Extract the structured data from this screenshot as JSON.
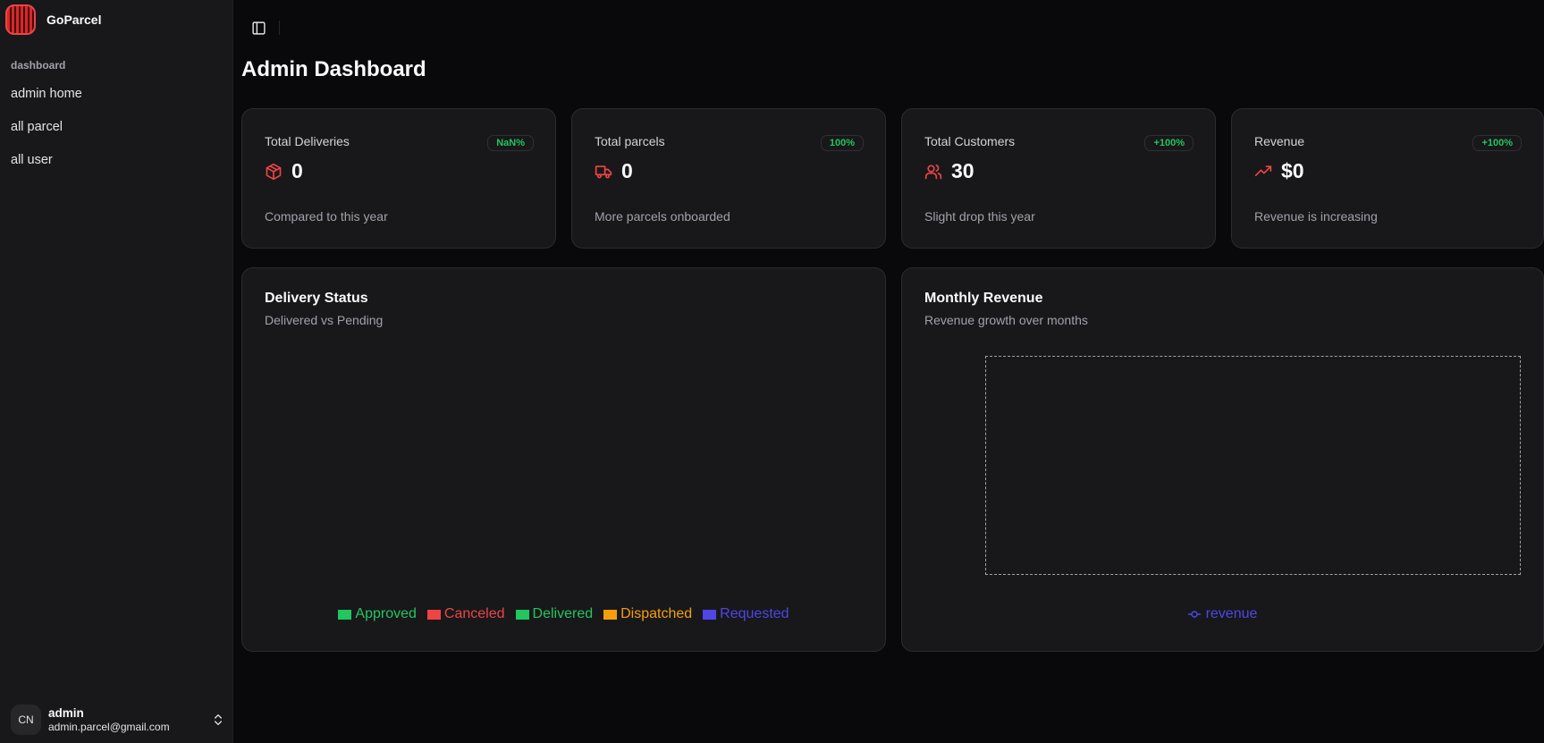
{
  "app": {
    "name": "GoParcel"
  },
  "sidebar": {
    "group_label": "dashboard",
    "items": [
      {
        "label": "admin home"
      },
      {
        "label": "all parcel"
      },
      {
        "label": "all user"
      }
    ],
    "user": {
      "initials": "CN",
      "name": "admin",
      "email": "admin.parcel@gmail.com"
    }
  },
  "main": {
    "title": "Admin Dashboard",
    "stats": [
      {
        "label": "Total Deliveries",
        "badge": "NaN%",
        "value": "0",
        "footer": "Compared to this year",
        "icon": "package-icon"
      },
      {
        "label": "Total parcels",
        "badge": "100%",
        "value": "0",
        "footer": "More parcels onboarded",
        "icon": "truck-icon"
      },
      {
        "label": "Total Customers",
        "badge": "+100%",
        "value": "30",
        "footer": "Slight drop this year",
        "icon": "users-icon"
      },
      {
        "label": "Revenue",
        "badge": "+100%",
        "value": "$0",
        "footer": "Revenue is increasing",
        "icon": "trending-up-icon"
      }
    ],
    "delivery_chart": {
      "title": "Delivery Status",
      "subtitle": "Delivered vs Pending"
    },
    "revenue_chart": {
      "title": "Monthly Revenue",
      "subtitle": "Revenue growth over months"
    }
  },
  "colors": {
    "accent_red": "#ef4444",
    "success": "#22c55e",
    "approved": "#22c55e",
    "canceled": "#ef4444",
    "delivered": "#22c55e",
    "dispatched": "#f59e0b",
    "requested": "#4f46e5"
  },
  "chart_data": [
    {
      "type": "pie",
      "title": "Delivery Status",
      "subtitle": "Delivered vs Pending",
      "legend": [
        "Approved",
        "Canceled",
        "Delivered",
        "Dispatched",
        "Requested"
      ],
      "values": [],
      "legend_position": "bottom"
    },
    {
      "type": "line",
      "title": "Monthly Revenue",
      "subtitle": "Revenue growth over months",
      "series": [
        {
          "name": "revenue",
          "values": []
        }
      ],
      "x": [],
      "legend_position": "bottom"
    }
  ]
}
